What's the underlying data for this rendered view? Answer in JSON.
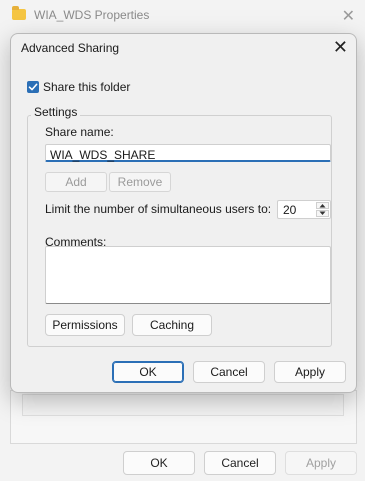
{
  "background_window": {
    "title": "WIA_WDS Properties",
    "buttons": {
      "ok": "OK",
      "cancel": "Cancel",
      "apply": "Apply"
    }
  },
  "dialog": {
    "title": "Advanced Sharing",
    "share_checkbox": {
      "label": "Share this folder",
      "checked": true
    },
    "settings": {
      "group_label": "Settings",
      "share_name_label": "Share name:",
      "share_name_value": "WIA_WDS_SHARE",
      "add_label": "Add",
      "remove_label": "Remove",
      "limit_label": "Limit the number of simultaneous users to:",
      "limit_value": "20",
      "comments_label": "Comments:",
      "comments_value": "",
      "permissions_label": "Permissions",
      "caching_label": "Caching"
    },
    "buttons": {
      "ok": "OK",
      "cancel": "Cancel",
      "apply": "Apply"
    }
  },
  "colors": {
    "accent": "#2b6fb6",
    "folder": "#f5c542"
  }
}
